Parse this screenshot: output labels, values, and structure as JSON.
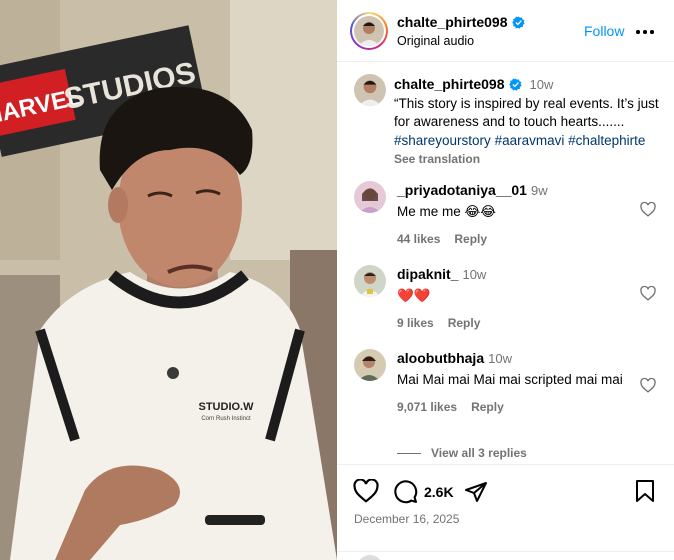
{
  "post": {
    "author": "chalte_phirte098",
    "audio": "Original audio",
    "follow_label": "Follow",
    "more_label": "More options",
    "caption": {
      "author": "chalte_phirte098",
      "time": "10w",
      "text": "“This story is inspired by real events. It’s just for awareness and to touch hearts.......",
      "hashtags": [
        "#shareyourstory",
        "#aaravmavi",
        "#chaltephirte"
      ],
      "see_translation": "See translation"
    },
    "video": {
      "sign_left": "MARVEL",
      "sign_right": "STUDIOS",
      "shirt_text": "STUDIO.W",
      "shirt_subtext": "Corn Rush Instinct"
    }
  },
  "comments": [
    {
      "username": "_priyadotaniya__01",
      "time": "9w",
      "text": "Me me me 😂😂",
      "likes": "44 likes",
      "reply": "Reply"
    },
    {
      "username": "dipaknit_",
      "time": "10w",
      "text": "❤️❤️",
      "likes": "9 likes",
      "reply": "Reply"
    },
    {
      "username": "aloobutbhaja",
      "time": "10w",
      "text": "Mai Mai mai Mai mai scripted mai mai",
      "likes": "9,071 likes",
      "reply": "Reply"
    }
  ],
  "view_replies": "View all 3 replies",
  "actions": {
    "comment_count": "2.6K",
    "date": "December 16, 2025"
  },
  "colors": {
    "link": "#0095f6",
    "hashtag": "#00376b",
    "muted": "#737373",
    "verified": "#0095f6"
  }
}
